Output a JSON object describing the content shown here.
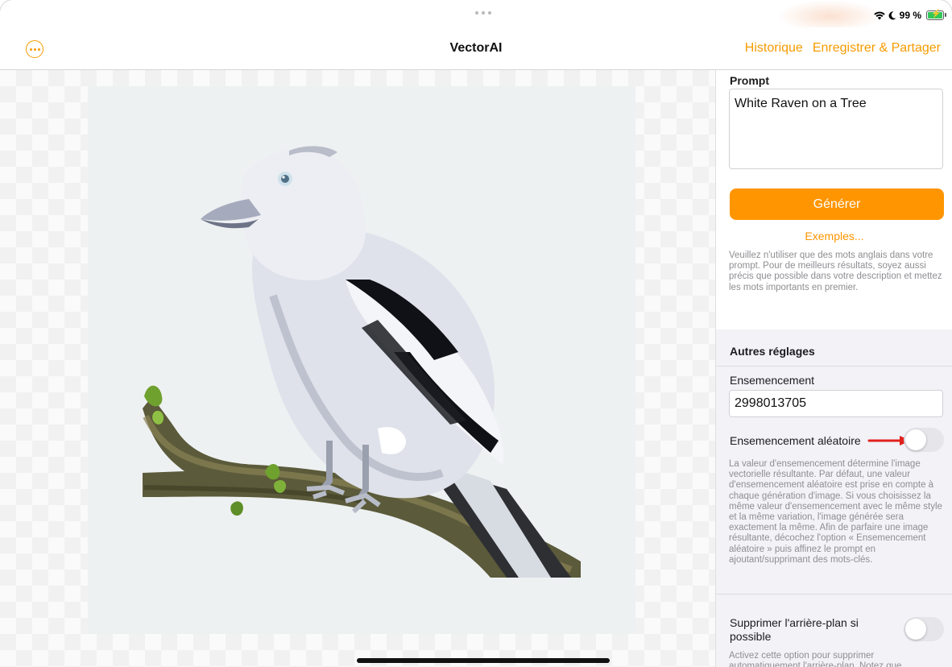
{
  "status_bar": {
    "battery_text": "99 %",
    "wifi_icon": "wifi-icon",
    "moon_icon": "moon-icon"
  },
  "nav": {
    "title": "VectorAI",
    "history": "Historique",
    "save_share": "Enregistrer & Partager"
  },
  "panel": {
    "prompt_label": "Prompt",
    "prompt_value": "White Raven on a Tree",
    "generate": "Générer",
    "examples": "Exemples...",
    "prompt_note": "Veuillez n'utiliser que des mots anglais dans votre prompt. Pour de meilleurs résultats, soyez aussi précis que possible dans votre description et mettez les mots importants en premier.",
    "other_settings": "Autres réglages",
    "seed_label": "Ensemencement",
    "seed_value": "2998013705",
    "random_seed_label": "Ensemencement aléatoire",
    "random_seed_on": false,
    "seed_note": "La valeur d'ensemencement détermine l'image vectorielle résultante. Par défaut, une valeur d'ensemencement aléatoire est prise en compte à chaque génération d'image. Si vous choisissez la même valeur d'ensemencement avec le même style et la même variation, l'image générée sera exactement la même. Afin de parfaire une image résultante, décochez l'option « Ensemencement aléatoire » puis affinez le prompt en ajoutant/supprimant des mots-clés.",
    "remove_bg_label": "Supprimer l'arrière-plan si possible",
    "remove_bg_on": false,
    "remove_bg_note": "Activez cette option pour supprimer automatiquement l'arrière-plan. Notez que"
  },
  "colors": {
    "accent": "#ff9500",
    "annotation_arrow": "#e0201b"
  }
}
